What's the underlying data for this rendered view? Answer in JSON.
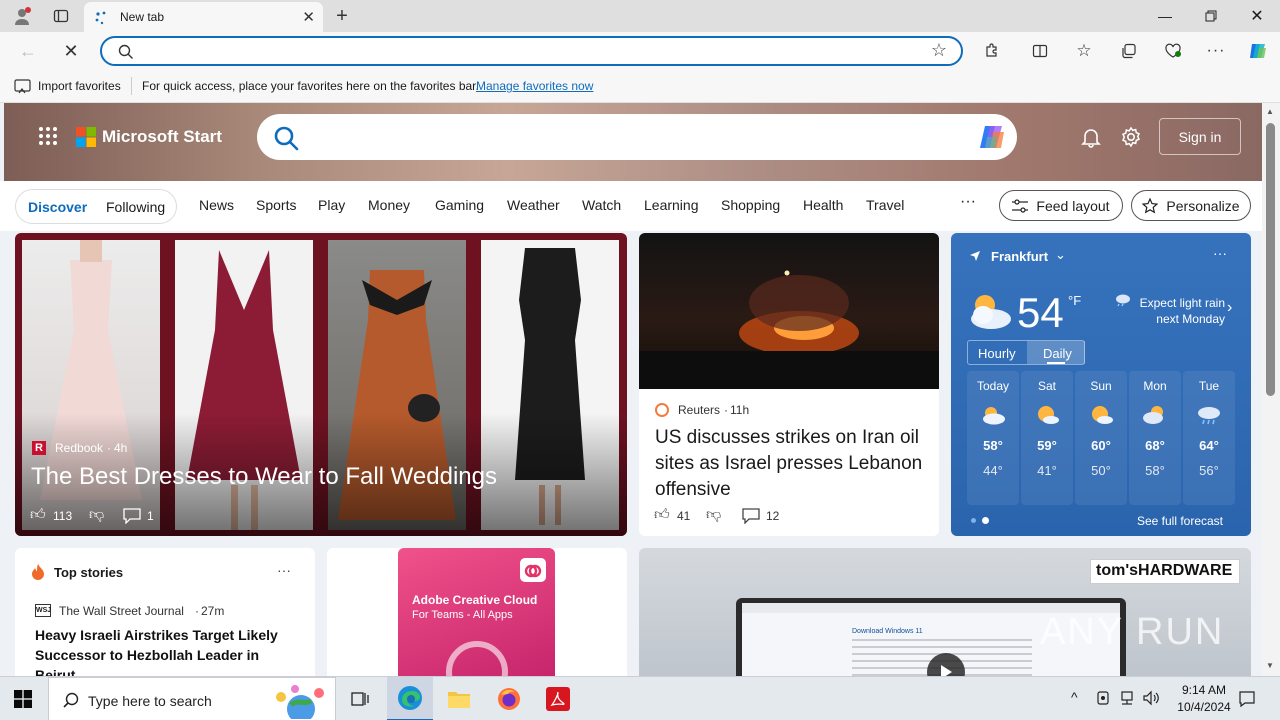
{
  "browser": {
    "tab_title": "New tab",
    "fav_import": "Import favorites",
    "fav_hint": "For quick access, place your favorites here on the favorites bar.",
    "fav_manage": "Manage favorites now"
  },
  "header": {
    "logo": "Microsoft Start",
    "signin": "Sign in"
  },
  "nav": {
    "discover": "Discover",
    "following": "Following",
    "items": [
      "News",
      "Sports",
      "Play",
      "Money",
      "Gaming",
      "Weather",
      "Watch",
      "Learning",
      "Shopping",
      "Health",
      "Travel"
    ],
    "more": "···",
    "feed_layout": "Feed layout",
    "personalize": "Personalize"
  },
  "hero_story": {
    "source": "Redbook",
    "age": "4h",
    "title": "The Best Dresses to Wear to Fall Weddings",
    "likes": "113",
    "comments": "1"
  },
  "reuters_story": {
    "source": "Reuters",
    "age": "11h",
    "title": "US discusses strikes on Iran oil sites as Israel presses Lebanon offensive",
    "likes": "41",
    "comments": "12"
  },
  "weather": {
    "city": "Frankfurt",
    "temp": "54",
    "unit": "°F",
    "note": "Expect light rain next Monday",
    "tab_hourly": "Hourly",
    "tab_daily": "Daily",
    "days": [
      {
        "name": "Today",
        "hi": "58°",
        "lo": "44°"
      },
      {
        "name": "Sat",
        "hi": "59°",
        "lo": "41°"
      },
      {
        "name": "Sun",
        "hi": "60°",
        "lo": "50°"
      },
      {
        "name": "Mon",
        "hi": "68°",
        "lo": "58°"
      },
      {
        "name": "Tue",
        "hi": "64°",
        "lo": "56°"
      }
    ],
    "forecast_link": "See full forecast"
  },
  "top_stories": {
    "title": "Top stories",
    "source": "The Wall Street Journal",
    "age": "27m",
    "headline": "Heavy Israeli Airstrikes Target Likely Successor to Hezbollah Leader in Beirut"
  },
  "ad": {
    "title": "Adobe Creative Cloud",
    "subtitle": "For Teams - All Apps"
  },
  "video": {
    "brand": "tom'sHARDWARE",
    "screen_title": "Download Windows 11"
  },
  "taskbar": {
    "search_placeholder": "Type here to search",
    "time": "9:14 AM",
    "date": "10/4/2024"
  },
  "watermark": "ANY RUN",
  "colors": {
    "accent": "#0f6cbd",
    "weather_bg": "#2f6db5",
    "redbook": "#c8102e",
    "adobe": "#e0346a"
  }
}
